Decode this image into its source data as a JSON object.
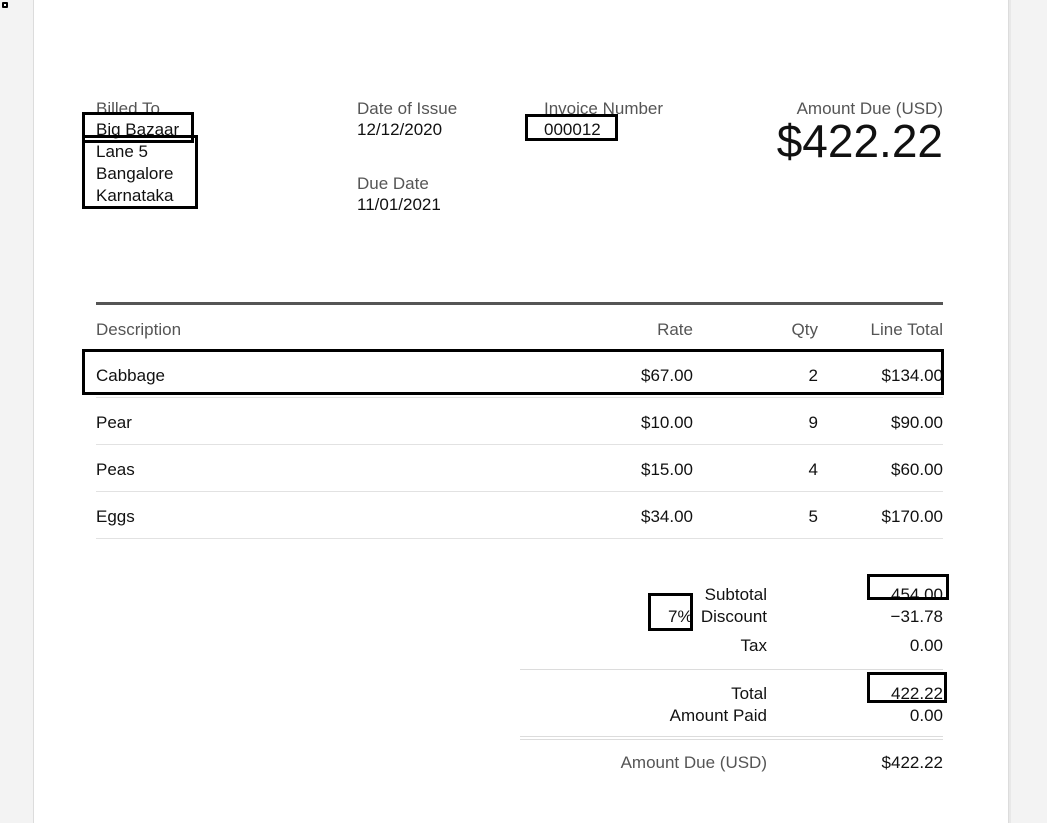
{
  "billed_to": {
    "label": "Billed To",
    "name": "Big Bazaar",
    "address": [
      "Lane 5",
      "Bangalore",
      "Karnataka"
    ]
  },
  "date_of_issue": {
    "label": "Date of Issue",
    "value": "12/12/2020"
  },
  "due_date": {
    "label": "Due Date",
    "value": "11/01/2021"
  },
  "invoice_number": {
    "label": "Invoice Number",
    "value": "000012"
  },
  "amount_due_header": {
    "label": "Amount Due (USD)",
    "value": "$422.22"
  },
  "table": {
    "headers": [
      "Description",
      "Rate",
      "Qty",
      "Line Total"
    ],
    "rows": [
      {
        "description": "Cabbage",
        "rate": "$67.00",
        "qty": "2",
        "line_total": "$134.00"
      },
      {
        "description": "Pear",
        "rate": "$10.00",
        "qty": "9",
        "line_total": "$90.00"
      },
      {
        "description": "Peas",
        "rate": "$15.00",
        "qty": "4",
        "line_total": "$60.00"
      },
      {
        "description": "Eggs",
        "rate": "$34.00",
        "qty": "5",
        "line_total": "$170.00"
      }
    ]
  },
  "summary": {
    "subtotal_label": "Subtotal",
    "subtotal_value": "454.00",
    "discount_percent": "7%",
    "discount_label": "Discount",
    "discount_value": "−31.78",
    "tax_label": "Tax",
    "tax_value": "0.00",
    "total_label": "Total",
    "total_value": "422.22",
    "amount_paid_label": "Amount Paid",
    "amount_paid_value": "0.00",
    "amount_due_label": "Amount Due (USD)",
    "amount_due_value": "$422.22"
  }
}
